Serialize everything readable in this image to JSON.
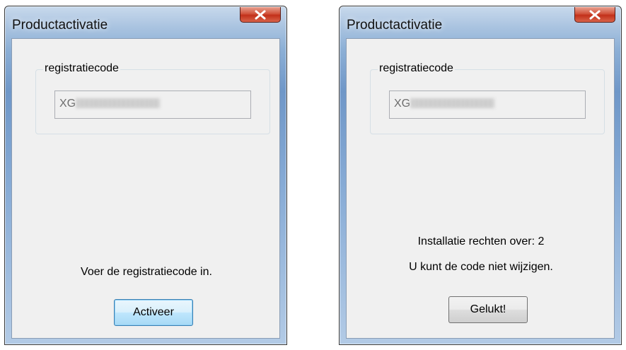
{
  "dialogs": [
    {
      "title": "Productactivatie",
      "close_icon": "close-icon",
      "group_label": "registratiecode",
      "code_prefix": "XG",
      "messages": [
        "Voer de registratiecode in."
      ],
      "button_label": "Activeer"
    },
    {
      "title": "Productactivatie",
      "close_icon": "close-icon",
      "group_label": "registratiecode",
      "code_prefix": "XG",
      "messages": [
        "Installatie rechten over: 2",
        "U kunt de code niet wijzigen."
      ],
      "button_label": "Gelukt!"
    }
  ],
  "colors": {
    "title_bar": "#8db0d6",
    "close_button": "#c2301a",
    "client_bg": "#f0f0f0",
    "default_button": "#bee6fd"
  }
}
